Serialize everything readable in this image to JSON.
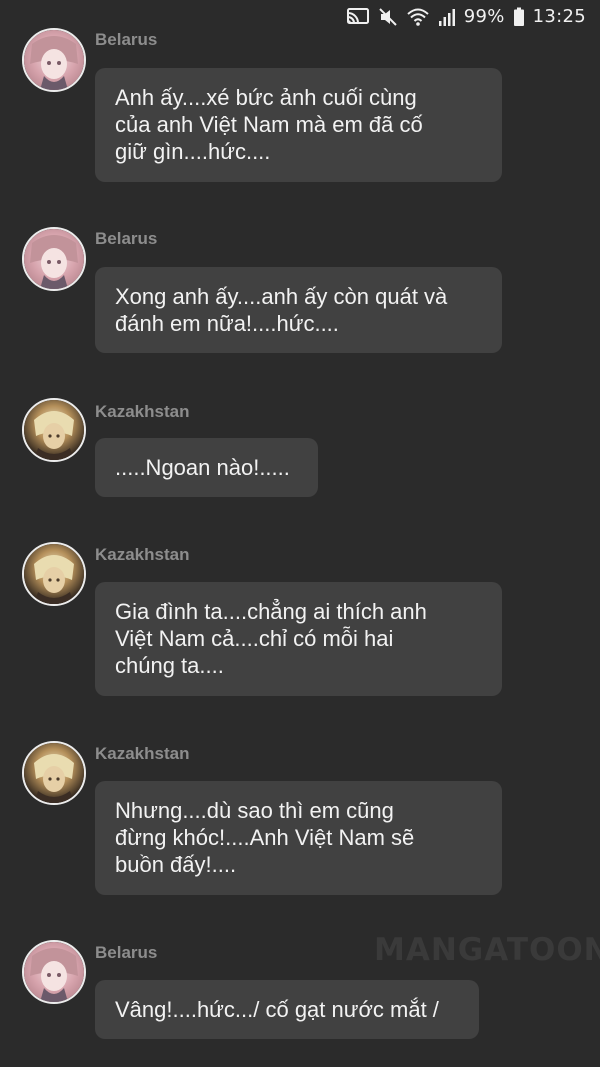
{
  "status_bar": {
    "battery": "99%",
    "time": "13:25",
    "icons": [
      "cast-icon",
      "mute-icon",
      "wifi-icon",
      "signal-icon",
      "battery-icon"
    ]
  },
  "messages": [
    {
      "sender": "Belarus",
      "avatar": "belarus-avatar",
      "text": "Anh ấy....xé bức ảnh cuối cùng\ncủa anh Việt Nam mà em đã cố\ngiữ gìn....hức...."
    },
    {
      "sender": "Belarus",
      "avatar": "belarus-avatar",
      "text": "Xong anh ấy....anh ấy còn quát và\nđánh em nữa!....hức...."
    },
    {
      "sender": "Kazakhstan",
      "avatar": "kazakhstan-avatar",
      "text": ".....Ngoan nào!....."
    },
    {
      "sender": "Kazakhstan",
      "avatar": "kazakhstan-avatar",
      "text": "Gia đình ta....chẳng ai thích anh\nViệt Nam cả....chỉ có mỗi hai\nchúng ta...."
    },
    {
      "sender": "Kazakhstan",
      "avatar": "kazakhstan-avatar",
      "text": "Nhưng....dù sao thì em cũng\nđừng khóc!....Anh Việt Nam sẽ\nbuồn đấy!...."
    },
    {
      "sender": "Belarus",
      "avatar": "belarus-avatar",
      "text": "Vâng!....hức.../ cố gạt nước mắt /"
    }
  ],
  "watermark": "MANGATOON",
  "colors": {
    "background": "#2b2b2b",
    "bubble": "#414141",
    "sender_name": "#8d8d8d",
    "message_text": "#f2f2f2"
  }
}
